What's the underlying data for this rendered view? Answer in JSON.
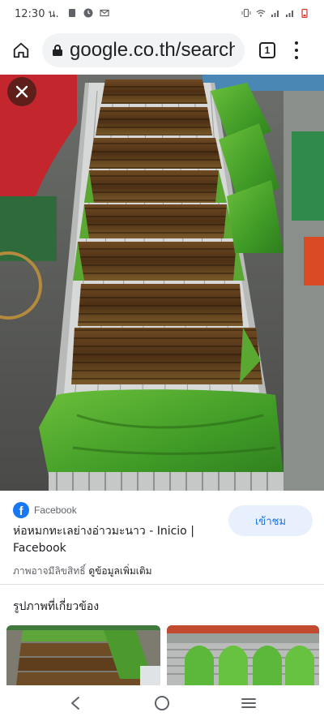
{
  "status_bar": {
    "time": "12:30 น.",
    "left_icons": [
      "sim-icon",
      "clock-icon",
      "gmail-icon"
    ],
    "right_icons": [
      "vibrate-icon",
      "wifi-icon",
      "signal-icon",
      "signal-icon",
      "battery-icon"
    ]
  },
  "browser": {
    "url": "google.co.th/search",
    "tab_count": "1",
    "icons": [
      "home-icon",
      "lock-icon",
      "overflow-menu-icon"
    ]
  },
  "image_viewer": {
    "close_icon": "close-icon",
    "alt": "ห่อหมกทะเลย่างอ่าวมะนาว"
  },
  "result": {
    "source": "Facebook",
    "title": "ห่อหมกทะเลย่างอ่าวมะนาว - Inicio | Facebook",
    "visit_label": "เข้าชม",
    "copyright_text": "ภาพอาจมีลิขสิทธิ์",
    "more_info_label": "ดูข้อมูลเพิ่มเติม"
  },
  "related": {
    "heading": "รูปภาพที่เกี่ยวข้อง"
  },
  "colors": {
    "accent": "#1a73e8",
    "visit_bg": "#e8f0fe",
    "facebook": "#1877f2",
    "close_bg": "#5a3228"
  },
  "nav_bar": {
    "icons": [
      "back-icon",
      "home-circle-icon",
      "recents-icon"
    ]
  }
}
